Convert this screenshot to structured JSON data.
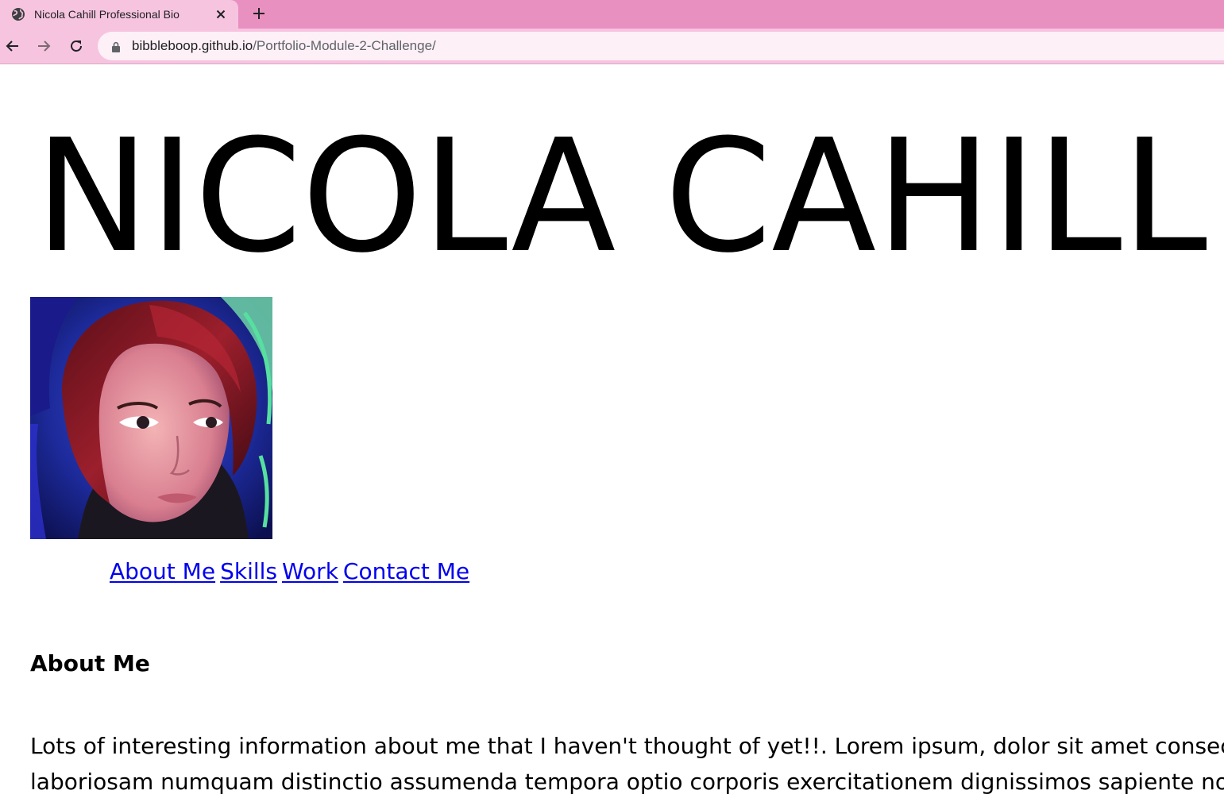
{
  "browser": {
    "tab_title": "Nicola Cahill Professional Bio",
    "url_host": "bibbleboop.github.io",
    "url_path": "/Portfolio-Module-2-Challenge/",
    "icons": {
      "tab": "globe-icon",
      "close": "close-icon",
      "new_tab": "plus-icon",
      "back": "arrow-left-icon",
      "forward": "arrow-right-icon",
      "reload": "reload-icon",
      "lock": "lock-icon"
    },
    "colors": {
      "tab_strip": "#e891c0",
      "toolbar": "#f7c4e0",
      "omnibox": "#fdf0f7"
    }
  },
  "page": {
    "hero_name": "NICOLA CAHILL",
    "nav": {
      "about": "About Me",
      "skills": "Skills",
      "work": "Work",
      "contact": "Contact Me"
    },
    "about_heading": "About Me",
    "bio_line1": "Lots of interesting information about me that I haven't thought of yet!!. Lorem ipsum, dolor sit amet consectetur",
    "bio_line2": "laboriosam numquam distinctio assumenda tempora optio corporis exercitationem dignissimos sapiente non, dui",
    "colors": {
      "link": "#0000ee",
      "text": "#000000",
      "background": "#ffffff"
    }
  }
}
